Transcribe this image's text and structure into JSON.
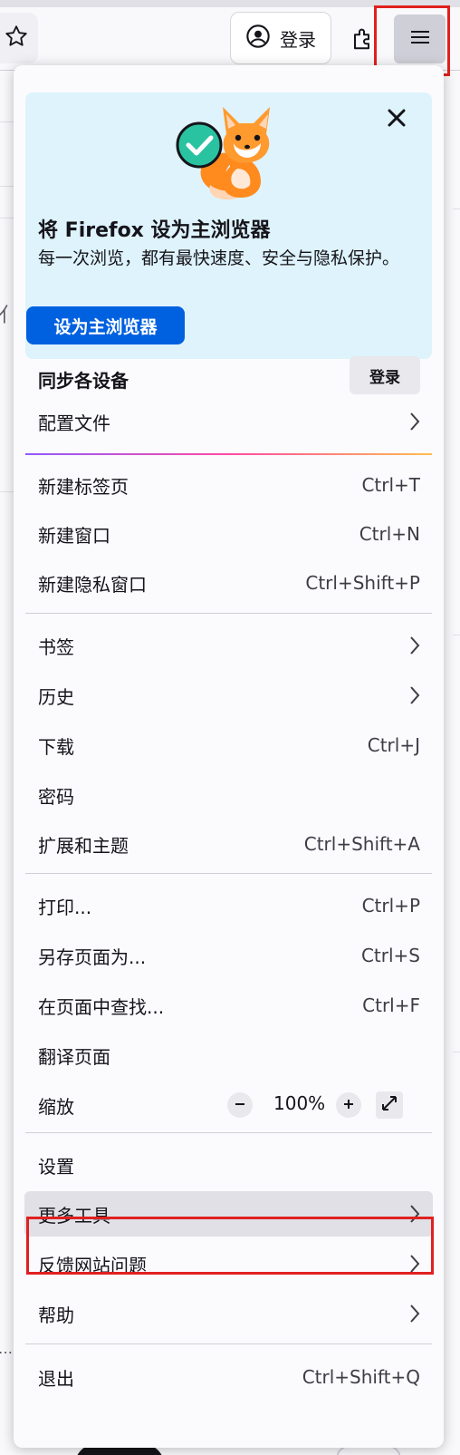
{
  "toolbar": {
    "signin_label": "登录"
  },
  "promo": {
    "title": "将 Firefox 设为主浏览器",
    "body": "每一次浏览，都有最快速度、安全与隐私保护。",
    "cta": "设为主浏览器"
  },
  "sync": {
    "title": "同步各设备",
    "signin": "登录"
  },
  "menu": {
    "profiles": "配置文件",
    "new_tab": {
      "label": "新建标签页",
      "shortcut": "Ctrl+T"
    },
    "new_window": {
      "label": "新建窗口",
      "shortcut": "Ctrl+N"
    },
    "new_private": {
      "label": "新建隐私窗口",
      "shortcut": "Ctrl+Shift+P"
    },
    "bookmarks": "书签",
    "history": "历史",
    "downloads": {
      "label": "下载",
      "shortcut": "Ctrl+J"
    },
    "passwords": "密码",
    "addons": {
      "label": "扩展和主题",
      "shortcut": "Ctrl+Shift+A"
    },
    "print": {
      "label": "打印...",
      "shortcut": "Ctrl+P"
    },
    "save_as": {
      "label": "另存页面为...",
      "shortcut": "Ctrl+S"
    },
    "find": {
      "label": "在页面中查找...",
      "shortcut": "Ctrl+F"
    },
    "translate": "翻译页面",
    "zoom": {
      "label": "缩放",
      "value": "100%"
    },
    "settings": "设置",
    "more_tools": "更多工具",
    "report_site": "反馈网站问题",
    "help": "帮助",
    "quit": {
      "label": "退出",
      "shortcut": "Ctrl+Shift+Q"
    }
  },
  "colors": {
    "promo_bg": "#def3fc",
    "cta_blue": "#0061e0",
    "highlight_red": "#e02020",
    "active_row": "#e0e0e6"
  },
  "icons": [
    "star-icon",
    "account-icon",
    "extensions-icon",
    "hamburger-menu-icon",
    "fox-illustration",
    "close-icon",
    "chevron-right-icon",
    "minus-icon",
    "plus-icon",
    "fullscreen-icon"
  ]
}
